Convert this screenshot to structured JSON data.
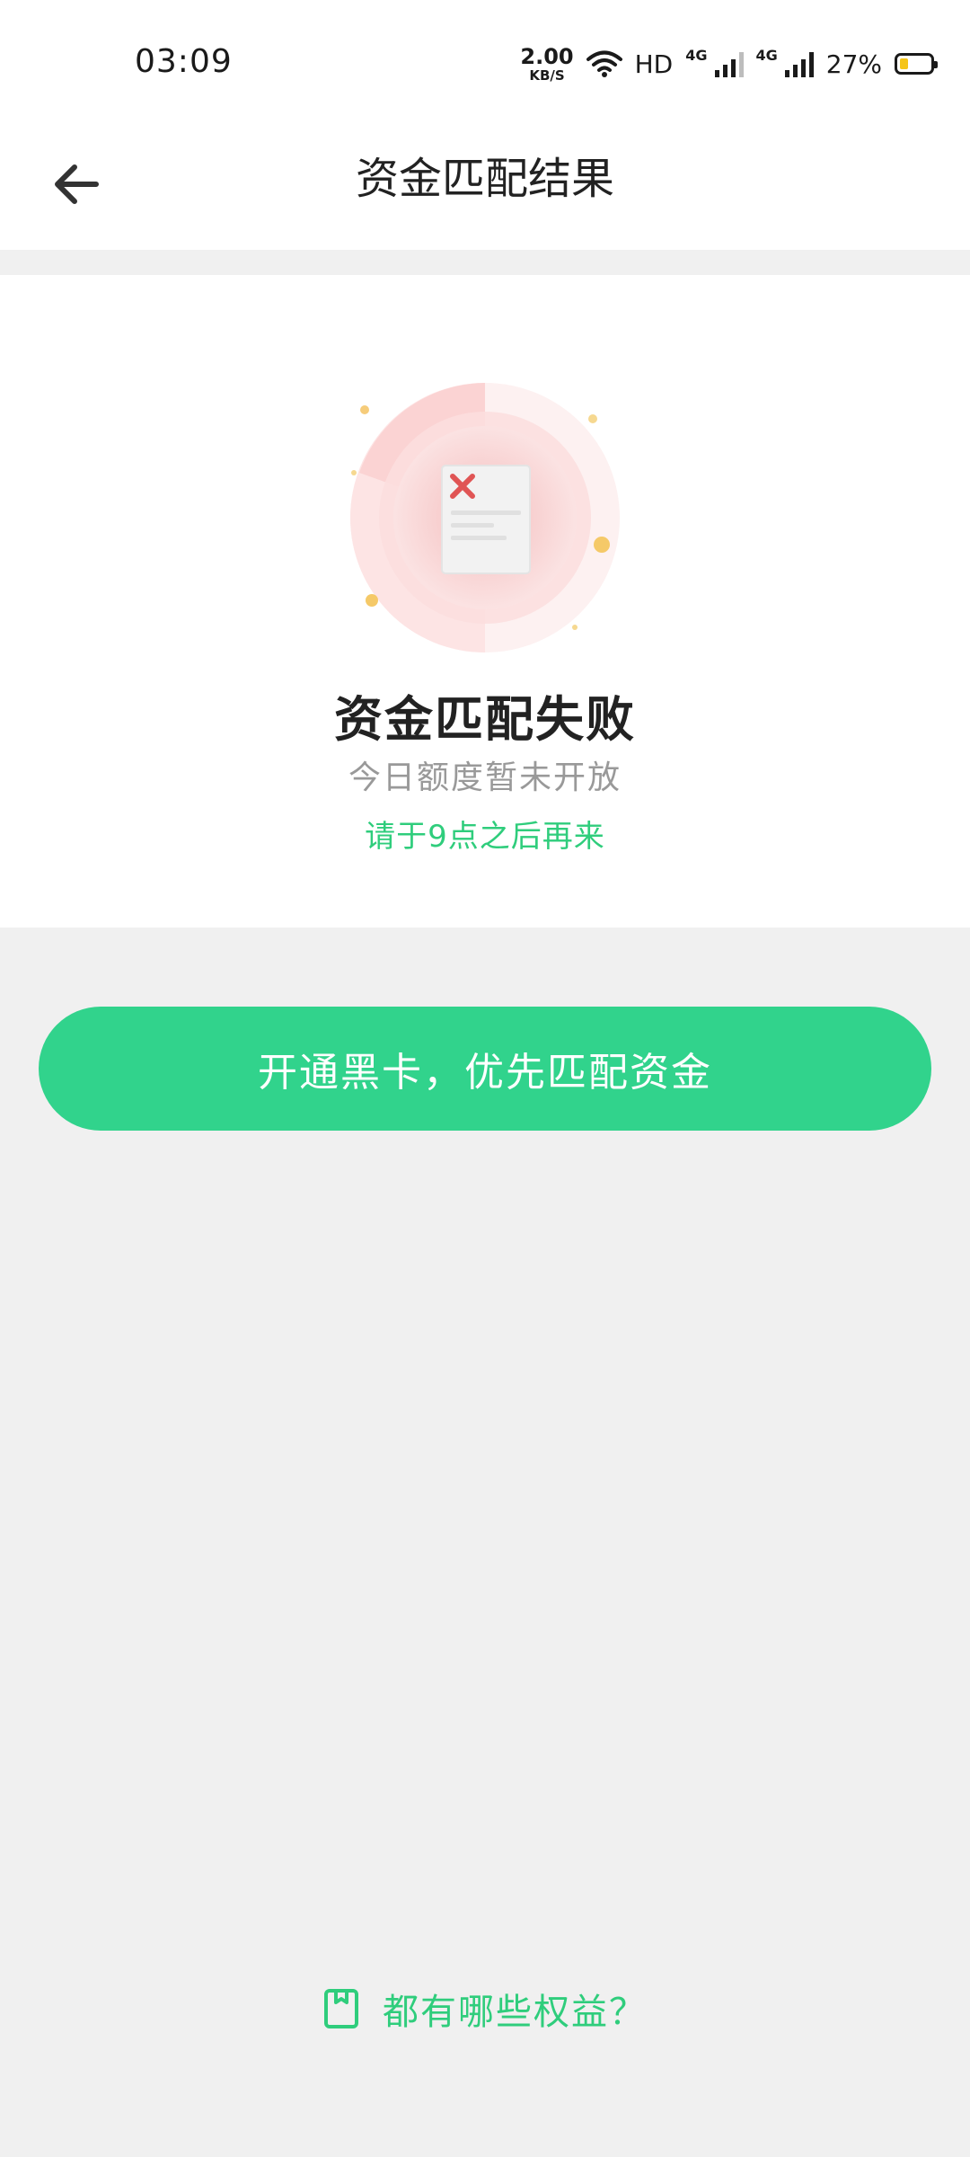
{
  "status_bar": {
    "time": "03:09",
    "net_speed_value": "2.00",
    "net_speed_unit": "KB/S",
    "hd_label": "HD",
    "network_1": "4G",
    "network_2": "4G",
    "battery_percent": "27%"
  },
  "nav": {
    "title": "资金匹配结果"
  },
  "result": {
    "title": "资金匹配失败",
    "subtitle": "今日额度暂未开放",
    "hint": "请于9点之后再来"
  },
  "cta": {
    "label": "开通黑卡，优先匹配资金"
  },
  "benefits": {
    "label": "都有哪些权益？"
  },
  "colors": {
    "accent_green": "#31d38c",
    "error_red": "#e05555",
    "text_gray": "#999999"
  }
}
